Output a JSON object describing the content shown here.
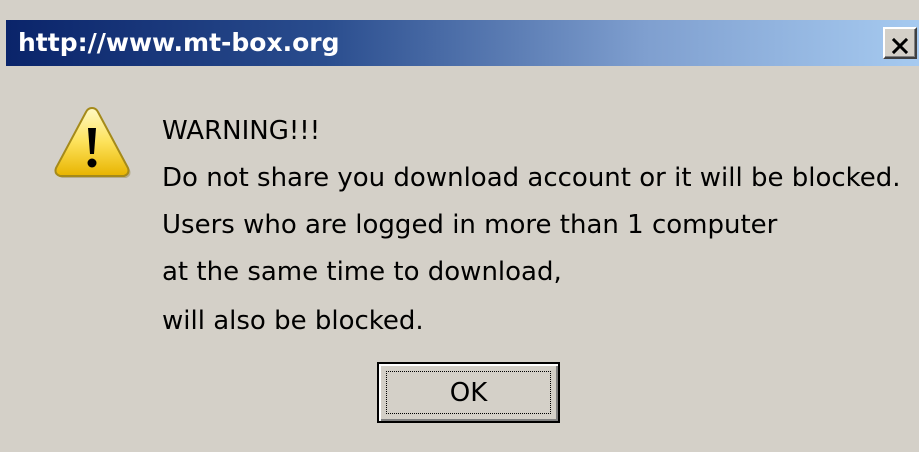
{
  "window": {
    "title": "http://www.mt-box.org",
    "close_icon": "close-icon",
    "colors": {
      "titlebar_start": "#0a246a",
      "titlebar_end": "#a6caf0",
      "face": "#d4d0c8"
    }
  },
  "alert": {
    "icon": "warning-icon",
    "lines": [
      "WARNING!!!",
      "Do not share you download account or it will be blocked.",
      "Users who are logged in more than 1 computer",
      "at the same time to download,",
      "will also be blocked."
    ]
  },
  "buttons": {
    "ok_label": "OK"
  }
}
